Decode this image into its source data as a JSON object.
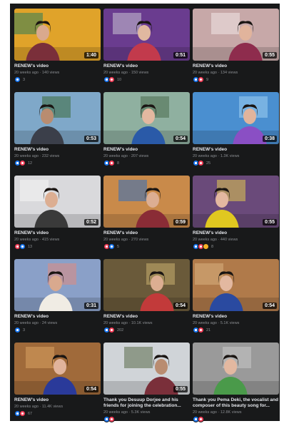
{
  "videos": [
    {
      "title": "RENEW's video",
      "meta": "20 weeks ago · 140 views",
      "duration": "1:40",
      "reactions": [
        "like"
      ],
      "count": "3",
      "bg": "#e0a32a",
      "accent": "#2f7d58",
      "person": "#7a2f3a",
      "face": "#d9a98e"
    },
    {
      "title": "RENEW's video",
      "meta": "20 weeks ago · 150 views",
      "duration": "0:51",
      "reactions": [
        "like",
        "love"
      ],
      "count": "10",
      "bg": "#6a3c8f",
      "accent": "#c8c3d3",
      "person": "#c23a4c",
      "face": "#e0b8a0"
    },
    {
      "title": "RENEW's video",
      "meta": "20 weeks ago · 134 views",
      "duration": "0:55",
      "reactions": [
        "like",
        "love"
      ],
      "count": "9",
      "bg": "#c7a8a8",
      "accent": "#f0e6e6",
      "person": "#8e2c4d",
      "face": "#e1b49c"
    },
    {
      "title": "RENEW's video",
      "meta": "20 weeks ago · 232 views",
      "duration": "0:53",
      "reactions": [
        "like",
        "love"
      ],
      "count": "12",
      "bg": "#7fa8c9",
      "accent": "#3d6a3b",
      "person": "#3b3f4a",
      "face": "#b98c70"
    },
    {
      "title": "RENEW's video",
      "meta": "20 weeks ago · 207 views",
      "duration": "0:54",
      "reactions": [
        "like",
        "love"
      ],
      "count": "8",
      "bg": "#8fb0a0",
      "accent": "#4a6b4d",
      "person": "#2a5aa8",
      "face": "#e3b8a0"
    },
    {
      "title": "RENEW's video",
      "meta": "20 weeks ago · 1.3K views",
      "duration": "0:38",
      "reactions": [
        "like",
        "love"
      ],
      "count": "25",
      "bg": "#4a8fd0",
      "accent": "#9fd0f0",
      "person": "#8a4fc4",
      "face": "#e1b49c"
    },
    {
      "title": "RENEW's video",
      "meta": "20 weeks ago · 415 views",
      "duration": "0:52",
      "reactions": [
        "love",
        "like"
      ],
      "count": "13",
      "bg": "#d9d9dc",
      "accent": "#f5f5f5",
      "person": "#3a3a3a",
      "face": "#dcae92"
    },
    {
      "title": "RENEW's video",
      "meta": "20 weeks ago · 270 views",
      "duration": "0:59",
      "reactions": [
        "love",
        "like"
      ],
      "count": "5",
      "bg": "#c98a4a",
      "accent": "#2f6fc0",
      "person": "#8a2c36",
      "face": "#dcae92"
    },
    {
      "title": "RENEW's video",
      "meta": "20 weeks ago · 440 views",
      "duration": "0:55",
      "reactions": [
        "like",
        "love",
        "haha"
      ],
      "count": "8",
      "bg": "#6a4a7a",
      "accent": "#e0c850",
      "person": "#e0c820",
      "face": "#e3b8a0"
    },
    {
      "title": "RENEW's video",
      "meta": "20 weeks ago · 24 views",
      "duration": "0:31",
      "reactions": [
        "like"
      ],
      "count": "3",
      "bg": "#8aa0c8",
      "accent": "#e08a80",
      "person": "#f0ece4",
      "face": "#d9a98e"
    },
    {
      "title": "RENEW's video",
      "meta": "20 weeks ago · 10.1K views",
      "duration": "0:54",
      "reactions": [
        "like",
        "love"
      ],
      "count": "202",
      "bg": "#6a5a3a",
      "accent": "#c8b070",
      "person": "#c23a3a",
      "face": "#dcae92"
    },
    {
      "title": "RENEW's video",
      "meta": "20 weeks ago · 5.1K views",
      "duration": "0:54",
      "reactions": [
        "like",
        "love"
      ],
      "count": "21",
      "bg": "#b07a4a",
      "accent": "#d8b080",
      "person": "#2a4aa0",
      "face": "#e3b8a0"
    },
    {
      "title": "RENEW's video",
      "meta": "20 weeks ago · 11.4K views",
      "duration": "0:54",
      "reactions": [
        "like",
        "love"
      ],
      "count": "67",
      "bg": "#a06a3a",
      "accent": "#d8a060",
      "person": "#2a3a9a",
      "face": "#e1b49c"
    },
    {
      "title": "Thank you Desuup Dorjee and his friends for joining the celebration...",
      "meta": "20 weeks ago · 5.3K views",
      "duration": "0:55",
      "reactions": [
        "like",
        "love"
      ],
      "count": "",
      "bg": "#d0d4d8",
      "accent": "#5a6a4a",
      "person": "#7a2f3a",
      "face": "#b98c70"
    },
    {
      "title": "Thank you Pema Deki, the vocalist and composer of this beauty song for...",
      "meta": "20 weeks ago · 12.8K views",
      "duration": "",
      "reactions": [
        "like",
        "love"
      ],
      "count": "",
      "bg": "#9a9a9a",
      "accent": "#c8c8c8",
      "person": "#4a9a4a",
      "face": "#e3b8a0"
    }
  ]
}
